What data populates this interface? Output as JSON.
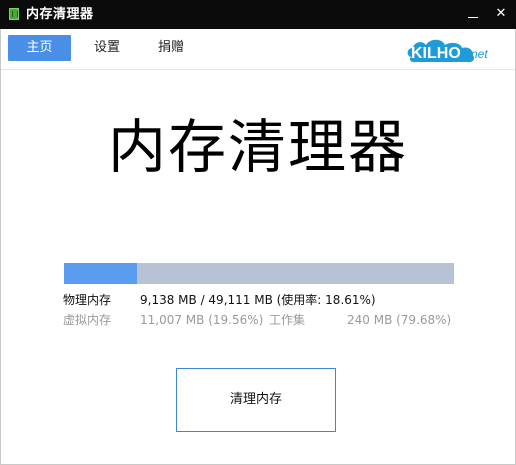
{
  "window": {
    "title": "内存清理器",
    "minimize_label": "─",
    "close_label": "✕"
  },
  "tabs": [
    {
      "label": "主页",
      "active": true
    },
    {
      "label": "设置",
      "active": false
    },
    {
      "label": "捐赠",
      "active": false
    }
  ],
  "logo": {
    "main": "KILHO",
    "suffix": "net"
  },
  "main": {
    "heading": "内存清理器",
    "usage_fraction": 0.1861,
    "physical_label": "物理内存",
    "physical_value": "9,138 MB / 49,111 MB (使用率: 18.61%)",
    "virtual_label": "虚拟内存",
    "virtual_value": "11,007 MB (19.56%)",
    "working_set_label": "工作集",
    "working_set_value": "240 MB (79.68%)",
    "clean_button": "清理内存"
  },
  "colors": {
    "accent": "#4a8fe6",
    "bar_fill": "#5a9cf0",
    "bar_track": "#b7c3d4",
    "titlebar": "#0b0b0b"
  }
}
